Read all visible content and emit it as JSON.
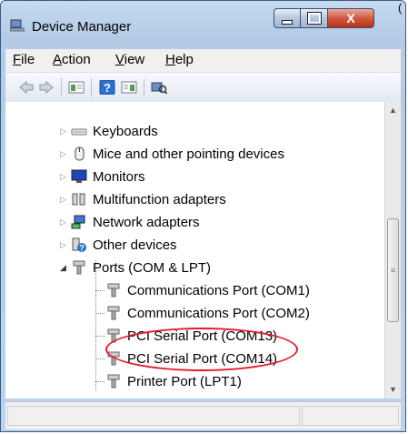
{
  "window": {
    "title": "Device Manager",
    "close_label": "X"
  },
  "corner_mark": "(",
  "menu": [
    {
      "key": "F",
      "rest": "ile"
    },
    {
      "key": "A",
      "rest": "ction"
    },
    {
      "key": "V",
      "rest": "iew"
    },
    {
      "key": "H",
      "rest": "elp"
    }
  ],
  "tree": {
    "categories": [
      {
        "label": "Keyboards",
        "icon": "keyboard-icon"
      },
      {
        "label": "Mice and other pointing devices",
        "icon": "mouse-icon"
      },
      {
        "label": "Monitors",
        "icon": "monitor-icon"
      },
      {
        "label": "Multifunction adapters",
        "icon": "multifunction-icon"
      },
      {
        "label": "Network adapters",
        "icon": "network-icon"
      },
      {
        "label": "Other devices",
        "icon": "unknown-device-icon"
      },
      {
        "label": "Ports (COM & LPT)",
        "icon": "port-icon",
        "expanded": true
      }
    ],
    "ports": [
      {
        "label": "Communications Port (COM1)"
      },
      {
        "label": "Communications Port (COM2)"
      },
      {
        "label": "PCI Serial Port (COM13)"
      },
      {
        "label": "PCI Serial Port (COM14)"
      },
      {
        "label": "Printer Port (LPT1)"
      }
    ]
  },
  "colors": {
    "highlight_ellipse": "#e21c2a",
    "close_button": "#c8432a"
  }
}
